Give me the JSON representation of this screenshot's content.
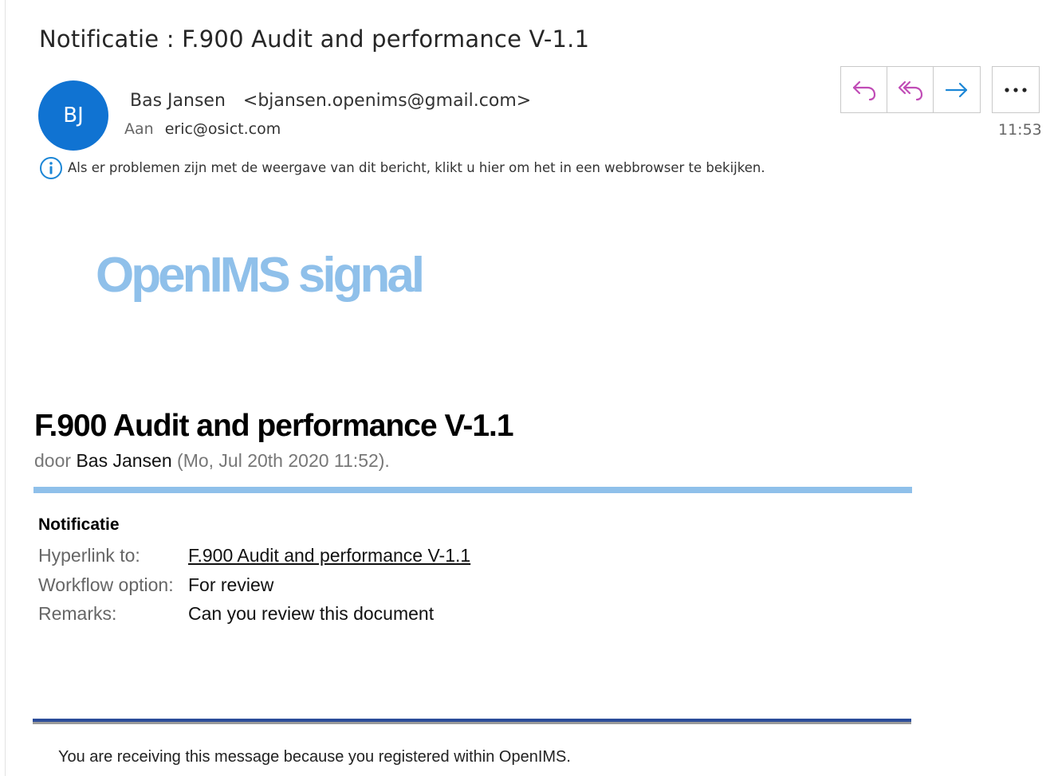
{
  "email": {
    "subject": "Notificatie : F.900 Audit and performance V-1.1",
    "avatar_initials": "BJ",
    "sender_name": "Bas Jansen",
    "sender_email": "<bjansen.openims@gmail.com>",
    "to_label": "Aan",
    "to_value": "eric@osict.com",
    "time": "11:53",
    "info_message": "Als er problemen zijn met de weergave van dit bericht, klikt u hier om het in een webbrowser te bekijken."
  },
  "toolbar": {
    "reply_icon": "reply-icon",
    "reply_all_icon": "reply-all-icon",
    "forward_icon": "forward-icon",
    "more_icon": "more-icon"
  },
  "body": {
    "logo_text": "OpenIMS signal",
    "title": "F.900 Audit and performance V-1.1",
    "byline_prefix": "door ",
    "byline_author": "Bas Jansen",
    "byline_date": " (Mo, Jul 20th 2020 11:52).",
    "section_title": "Notificatie",
    "fields": [
      {
        "label": "Hyperlink to:",
        "value": "F.900 Audit and performance V-1.1"
      },
      {
        "label": "Workflow option:",
        "value": "For review"
      },
      {
        "label": "Remarks:",
        "value": "Can you review this document"
      }
    ],
    "footer": "You are receiving this message because you registered within OpenIMS."
  },
  "colors": {
    "avatar": "#1073d2",
    "reply_icon": "#c04cb6",
    "forward_icon": "#1b86d6",
    "logo": "#8fc0ea",
    "footer_rule": "#2c4d9a"
  }
}
